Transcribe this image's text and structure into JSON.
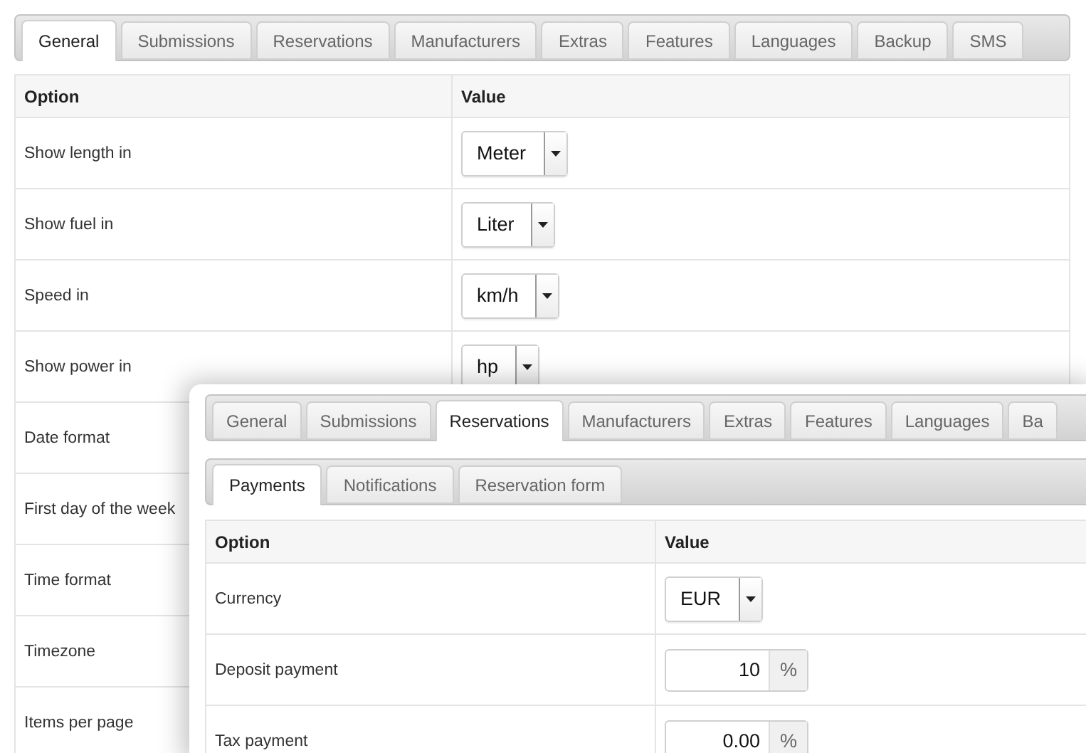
{
  "main_panel": {
    "tabs": [
      {
        "label": "General",
        "selected": true
      },
      {
        "label": "Submissions",
        "selected": false
      },
      {
        "label": "Reservations",
        "selected": false
      },
      {
        "label": "Manufacturers",
        "selected": false
      },
      {
        "label": "Extras",
        "selected": false
      },
      {
        "label": "Features",
        "selected": false
      },
      {
        "label": "Languages",
        "selected": false
      },
      {
        "label": "Backup",
        "selected": false
      },
      {
        "label": "SMS",
        "selected": false
      }
    ],
    "table": {
      "columns": [
        "Option",
        "Value"
      ],
      "rows": [
        {
          "option": "Show length in",
          "value": {
            "kind": "select",
            "text": "Meter"
          }
        },
        {
          "option": "Show fuel in",
          "value": {
            "kind": "select",
            "text": "Liter"
          }
        },
        {
          "option": "Speed in",
          "value": {
            "kind": "select",
            "text": "km/h"
          }
        },
        {
          "option": "Show power in",
          "value": {
            "kind": "select",
            "text": "hp"
          }
        },
        {
          "option": "Date format"
        },
        {
          "option": "First day of the week"
        },
        {
          "option": "Time format"
        },
        {
          "option": "Timezone"
        },
        {
          "option": "Items per page"
        }
      ]
    }
  },
  "overlay_panel": {
    "tabs": [
      {
        "label": "General",
        "selected": false
      },
      {
        "label": "Submissions",
        "selected": false
      },
      {
        "label": "Reservations",
        "selected": true
      },
      {
        "label": "Manufacturers",
        "selected": false
      },
      {
        "label": "Extras",
        "selected": false
      },
      {
        "label": "Features",
        "selected": false
      },
      {
        "label": "Languages",
        "selected": false
      },
      {
        "label": "Ba",
        "selected": false
      }
    ],
    "subtabs": [
      {
        "label": "Payments",
        "selected": true
      },
      {
        "label": "Notifications",
        "selected": false
      },
      {
        "label": "Reservation form",
        "selected": false
      }
    ],
    "table": {
      "columns": [
        "Option",
        "Value"
      ],
      "rows": [
        {
          "option": "Currency",
          "value": {
            "kind": "select",
            "text": "EUR"
          }
        },
        {
          "option": "Deposit payment",
          "value": {
            "kind": "percent",
            "text": "10",
            "unit": "%"
          }
        },
        {
          "option": "Tax payment",
          "value": {
            "kind": "percent",
            "text": "0.00",
            "unit": "%"
          }
        }
      ]
    }
  }
}
